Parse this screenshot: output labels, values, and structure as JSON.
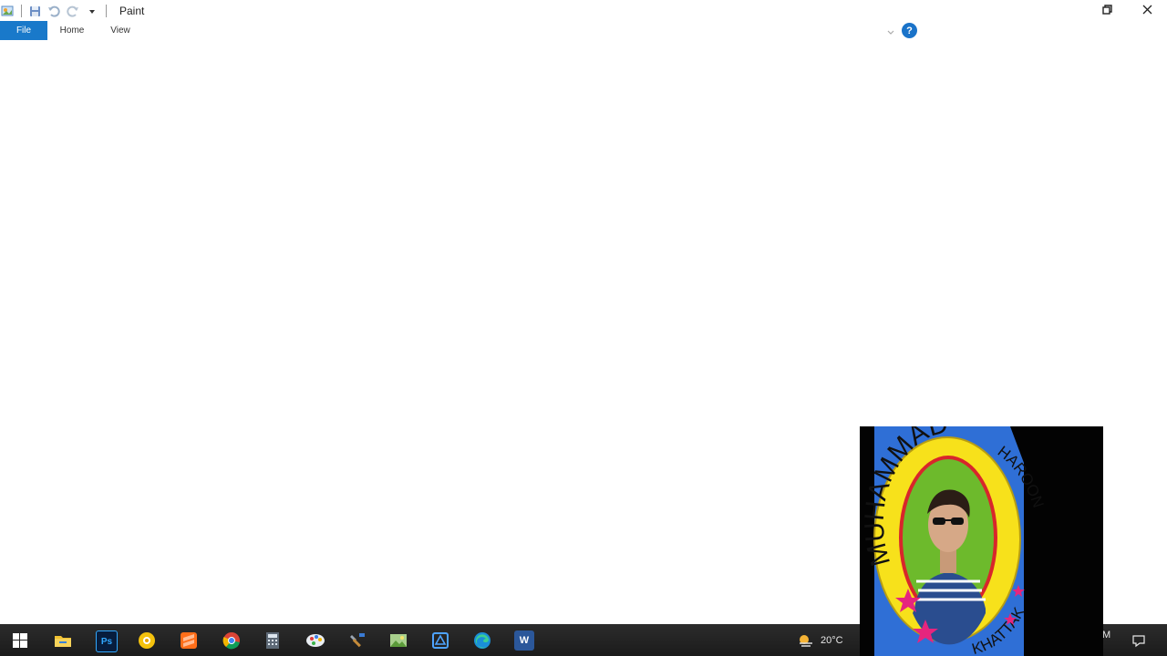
{
  "window": {
    "title": "Paint",
    "quick_access": [
      {
        "icon": "paint-app-icon"
      },
      {
        "icon": "save-icon"
      },
      {
        "icon": "undo-icon"
      },
      {
        "icon": "redo-icon"
      },
      {
        "icon": "customize-dropdown-icon"
      }
    ],
    "controls": [
      {
        "icon": "restore-icon"
      },
      {
        "icon": "close-icon"
      }
    ]
  },
  "ribbon": {
    "tabs": [
      {
        "id": "file",
        "label": "File",
        "active": true
      },
      {
        "id": "home",
        "label": "Home",
        "active": false
      },
      {
        "id": "view",
        "label": "View",
        "active": false
      }
    ],
    "help_label": "?",
    "accent": "#1979ca"
  },
  "taskbar": {
    "apps": [
      {
        "icon": "start-icon"
      },
      {
        "icon": "file-explorer-icon"
      },
      {
        "icon": "photoshop-icon",
        "label": "Ps"
      },
      {
        "icon": "media-app-icon"
      },
      {
        "icon": "sublime-text-icon"
      },
      {
        "icon": "chrome-icon"
      },
      {
        "icon": "calculator-icon"
      },
      {
        "icon": "paint-app-icon"
      },
      {
        "icon": "tool-app-icon"
      },
      {
        "icon": "image-viewer-icon"
      },
      {
        "icon": "snipping-tool-icon"
      },
      {
        "icon": "edge-icon"
      },
      {
        "icon": "word-icon",
        "label": "W"
      }
    ],
    "weather": {
      "icon": "weather-icon",
      "temperature": "20°C"
    },
    "clock_partial": "M",
    "notification_icon": "notification-icon"
  },
  "overlay": {
    "badge_text_top": "MUHAMMAD",
    "badge_text_right": "HAROON",
    "badge_text_bottom": "KHATTAK",
    "colors": {
      "ring": "#f7e11b",
      "inner": "#6dba2c",
      "rim": "#d8262b",
      "star": "#e6257e",
      "backdrop": "#2f6fd6"
    }
  }
}
